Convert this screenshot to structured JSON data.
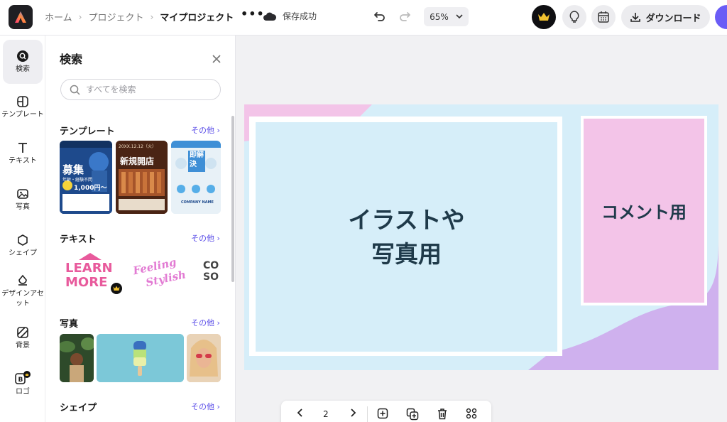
{
  "header": {
    "breadcrumb": [
      "ホーム",
      "プロジェクト",
      "マイプロジェクト"
    ],
    "more_label": "•••",
    "save_status": "保存成功",
    "zoom": "65%",
    "download_label": "ダウンロード"
  },
  "rail": {
    "items": [
      {
        "label": "検索",
        "icon": "search-circle-icon"
      },
      {
        "label": "テンプレート",
        "icon": "template-icon"
      },
      {
        "label": "テキスト",
        "icon": "text-icon"
      },
      {
        "label": "写真",
        "icon": "image-icon"
      },
      {
        "label": "シェイプ",
        "icon": "shape-icon"
      },
      {
        "label": "デザインアセット",
        "icon": "design-asset-icon"
      },
      {
        "label": "背景",
        "icon": "background-icon"
      },
      {
        "label": "ロゴ",
        "icon": "logo-icon"
      }
    ]
  },
  "panel": {
    "title": "検索",
    "search_placeholder": "すべてを検索",
    "sections": {
      "templates": {
        "title": "テンプレート",
        "more": "その他 ›"
      },
      "text": {
        "title": "テキスト",
        "more": "その他 ›"
      },
      "photos": {
        "title": "写真",
        "more": "その他 ›"
      },
      "shapes": {
        "title": "シェイプ",
        "more": "その他 ›"
      }
    },
    "template_thumbs": [
      {
        "headline": "募集",
        "sub": "年齢・経験不問",
        "price": "1,000円〜"
      },
      {
        "headline": "新規開店",
        "date": "20XX.12.12（火）"
      },
      {
        "headline": "即解決",
        "sub": "COMPANY NAME"
      }
    ],
    "text_samples": [
      {
        "line1": "LEARN",
        "line2": "MORE"
      },
      {
        "line1": "Feeling",
        "line2": "Stylish"
      },
      {
        "line1": "CO",
        "line2": "SO"
      }
    ]
  },
  "canvas": {
    "photo_label_line1": "イラストや",
    "photo_label_line2": "写真用",
    "comment_label": "コメント用",
    "colors": {
      "slide_bg": "#d6eef9",
      "pink": "#f3c4e8",
      "lavender": "#cfb1ee"
    }
  },
  "pagebar": {
    "page_number": "2"
  },
  "colors": {
    "accent": "#5a4de8",
    "crown": "#f2c230"
  }
}
